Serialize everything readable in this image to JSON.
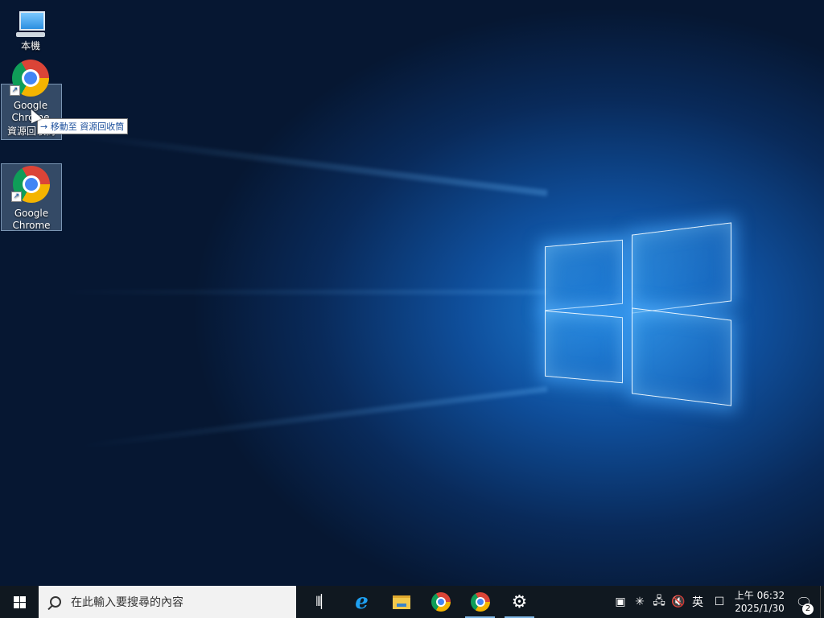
{
  "desktop": {
    "icons": [
      {
        "label": "本機",
        "icon": "computer-icon"
      },
      {
        "label": "Google Chrome",
        "icon": "chrome-icon",
        "dragging": true
      },
      {
        "label": "資源回收筒",
        "icon": "recycle-bin-icon"
      },
      {
        "label": "Google Chrome",
        "icon": "chrome-icon"
      }
    ],
    "drag_tooltip": {
      "arrow": "→",
      "label": "移動至",
      "target": "資源回收筒"
    },
    "dragging_label_fragment": "Chr"
  },
  "taskbar": {
    "search_placeholder": "在此輸入要搜尋的內容",
    "pinned": [
      "task-view",
      "internet-explorer",
      "file-explorer",
      "google-chrome",
      "google-chrome",
      "settings"
    ],
    "tray": {
      "input_method": "英",
      "time": "上午 06:32",
      "date": "2025/1/30",
      "notification_count": "2"
    }
  },
  "colors": {
    "taskbar": "#101820",
    "accent": "#1a6fd1"
  }
}
